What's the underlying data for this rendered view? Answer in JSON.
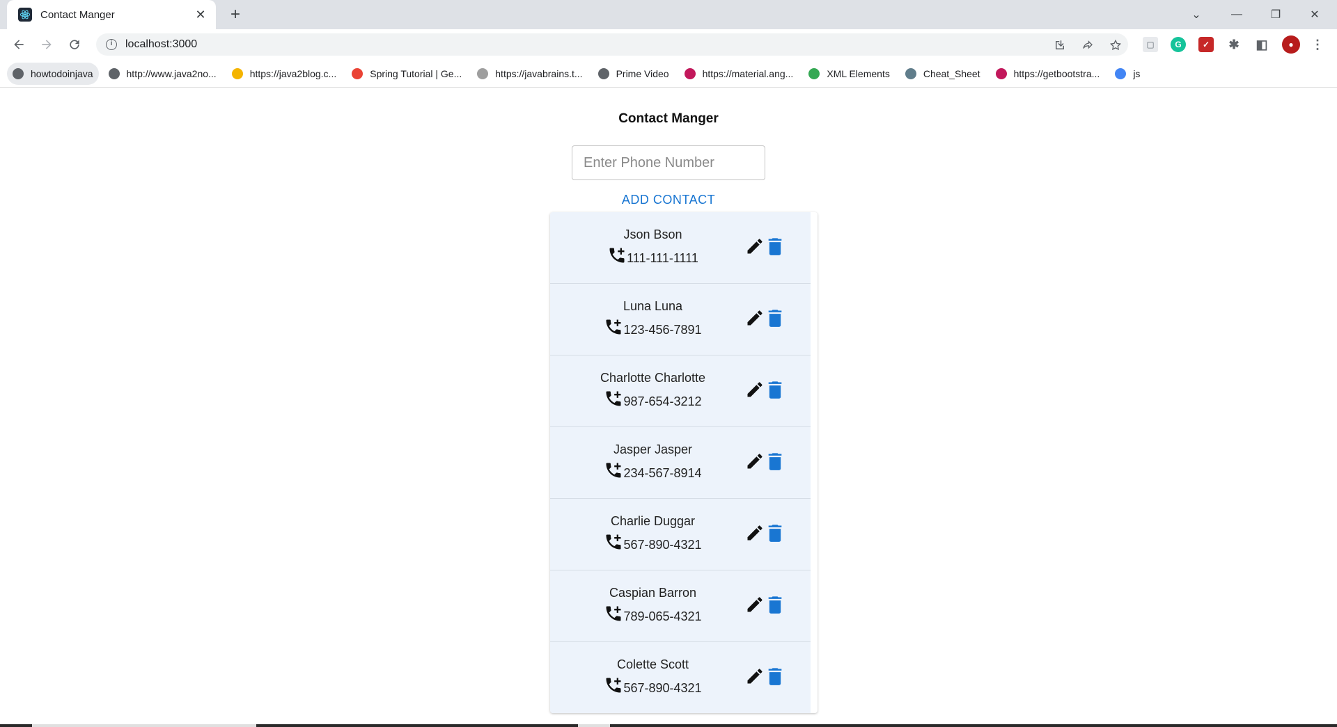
{
  "browser": {
    "tab_title": "Contact Manger",
    "tab_close": "✕",
    "new_tab": "+",
    "url": "localhost:3000",
    "window_controls": {
      "tab_search": "⌄",
      "minimize": "—",
      "restore": "❐",
      "close": "✕"
    },
    "bookmarks": [
      {
        "label": "howtodoinjava",
        "color": "#5f6368"
      },
      {
        "label": "http://www.java2no...",
        "color": "#5f6368"
      },
      {
        "label": "https://java2blog.c...",
        "color": "#f4b400"
      },
      {
        "label": "Spring Tutorial | Ge...",
        "color": "#ea4335"
      },
      {
        "label": "https://javabrains.t...",
        "color": "#9e9e9e"
      },
      {
        "label": "Prime Video",
        "color": "#5f6368"
      },
      {
        "label": "https://material.ang...",
        "color": "#c2185b"
      },
      {
        "label": "XML Elements",
        "color": "#34a853"
      },
      {
        "label": "Cheat_Sheet",
        "color": "#607d8b"
      },
      {
        "label": "https://getbootstra...",
        "color": "#c2185b"
      },
      {
        "label": "js",
        "color": "#4285f4"
      }
    ]
  },
  "app": {
    "title": "Contact Manger",
    "phone_placeholder": "Enter Phone Number",
    "add_button": "ADD CONTACT",
    "accent_color": "#1976d2",
    "contacts": [
      {
        "name": "Json Bson",
        "phone": "111-111-1111"
      },
      {
        "name": "Luna Luna",
        "phone": "123-456-7891"
      },
      {
        "name": "Charlotte Charlotte",
        "phone": "987-654-3212"
      },
      {
        "name": "Jasper Jasper",
        "phone": "234-567-8914"
      },
      {
        "name": "Charlie Duggar",
        "phone": "567-890-4321"
      },
      {
        "name": "Caspian Barron",
        "phone": "789-065-4321"
      },
      {
        "name": "Colette Scott",
        "phone": "567-890-4321"
      }
    ]
  }
}
